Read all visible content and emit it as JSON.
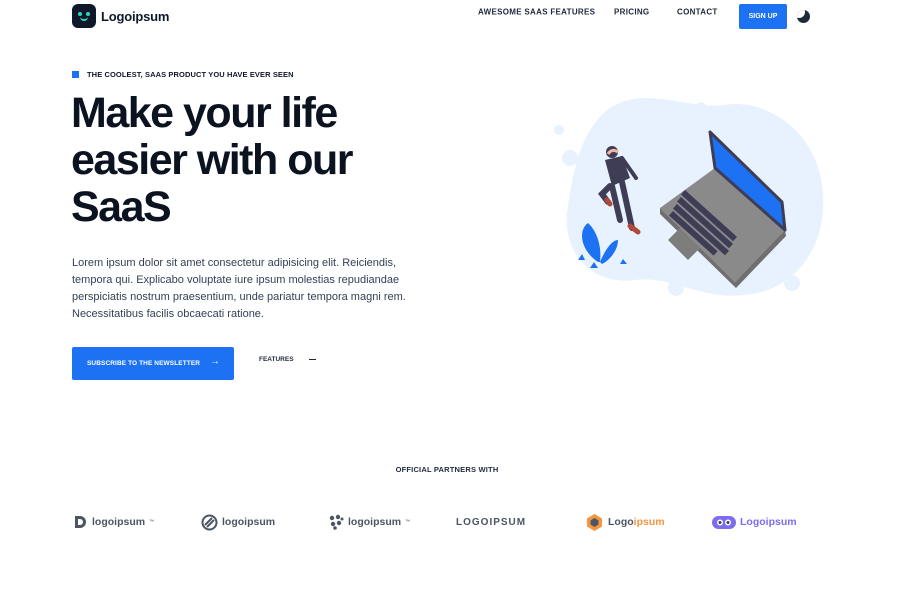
{
  "nav": {
    "logo_text": "Logoipsum",
    "links": [
      "AWESOME SAAS FEATURES",
      "PRICING",
      "CONTACT"
    ],
    "signup_label": "SIGN UP"
  },
  "hero": {
    "eyebrow": "THE COOLEST, SAAS PRODUCT YOU HAVE EVER SEEN",
    "headline_lines": [
      "Make your life",
      "easier with our",
      "SaaS"
    ],
    "lead": "Lorem ipsum dolor sit amet consectetur adipisicing elit. Reiciendis, tempora qui. Explicabo voluptate iure ipsum molestias repudiandae perspiciatis nostrum praesentium, unde pariatur tempora magni rem. Necessitatibus facilis obcaecati ratione.",
    "primary_cta": "SUBSCRIBE TO THE NEWSLETTER",
    "primary_cta_arrow": "→",
    "secondary_cta": "FEATURES"
  },
  "partners": {
    "title": "OFFICIAL PARTNERS WITH",
    "logos": [
      {
        "text": "logoipsum",
        "mark": "™"
      },
      {
        "text": "logoipsum",
        "mark": ""
      },
      {
        "text": "logoipsum",
        "mark": "™"
      },
      {
        "text": "LOGOIPSUM",
        "mark": ""
      },
      {
        "text_a": "Logo",
        "text_b": "ipsum"
      },
      {
        "text": "Logoipsum"
      }
    ]
  },
  "colors": {
    "accent": "#1d72f3",
    "dark": "#0f172a",
    "blob": "#e8f1fe",
    "partner_orange": "#f5953f",
    "partner_purple": "#7c6cf0"
  },
  "icons": {
    "theme_toggle": "moon-icon",
    "arrow": "arrow-right-icon"
  }
}
